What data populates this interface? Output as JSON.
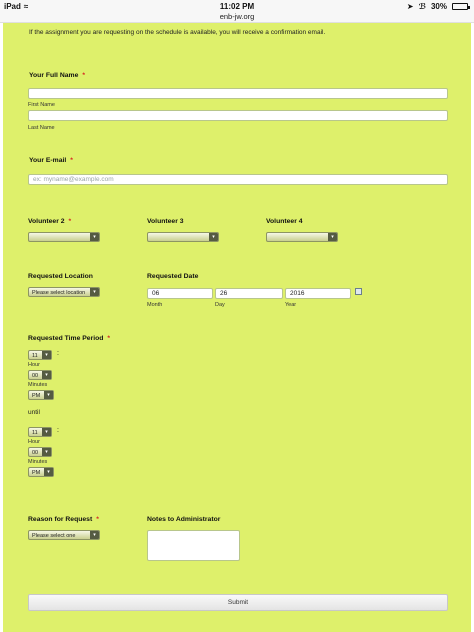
{
  "statusbar": {
    "device": "iPad",
    "time": "11:02 PM",
    "url": "enb-jw.org",
    "battery_text": "30%",
    "battery_level": 0.3
  },
  "form": {
    "intro": "If the assignment you are requesting on the schedule is available, you will receive a confirmation email.",
    "full_name": {
      "label": "Your Full Name",
      "required_mark": "*",
      "first_sublabel": "First Name",
      "last_sublabel": "Last Name",
      "first_value": "",
      "last_value": ""
    },
    "email": {
      "label": "Your E-mail",
      "required_mark": "*",
      "placeholder": "ex: myname@example.com"
    },
    "volunteers": [
      {
        "label": "Volunteer 2",
        "required_mark": "*",
        "value": ""
      },
      {
        "label": "Volunteer 3",
        "required_mark": "",
        "value": ""
      },
      {
        "label": "Volunteer 4",
        "required_mark": "",
        "value": ""
      }
    ],
    "location": {
      "label": "Requested Location",
      "value": "Please select location"
    },
    "date": {
      "label": "Requested Date",
      "month": "06",
      "day": "26",
      "year": "2016",
      "month_label": "Month",
      "day_label": "Day",
      "year_label": "Year"
    },
    "time_period": {
      "label": "Requested Time Period",
      "required_mark": "*",
      "colon": ":",
      "start": {
        "hour": "11",
        "minutes": "00",
        "ampm": "PM"
      },
      "until_label": "until",
      "end": {
        "hour": "11",
        "minutes": "00",
        "ampm": "PM"
      },
      "hour_label": "Hour",
      "minutes_label": "Minutes"
    },
    "reason": {
      "label": "Reason for Request",
      "required_mark": "*",
      "value": "Please select one"
    },
    "notes": {
      "label": "Notes to Administrator",
      "value": ""
    },
    "submit_label": "Submit"
  }
}
